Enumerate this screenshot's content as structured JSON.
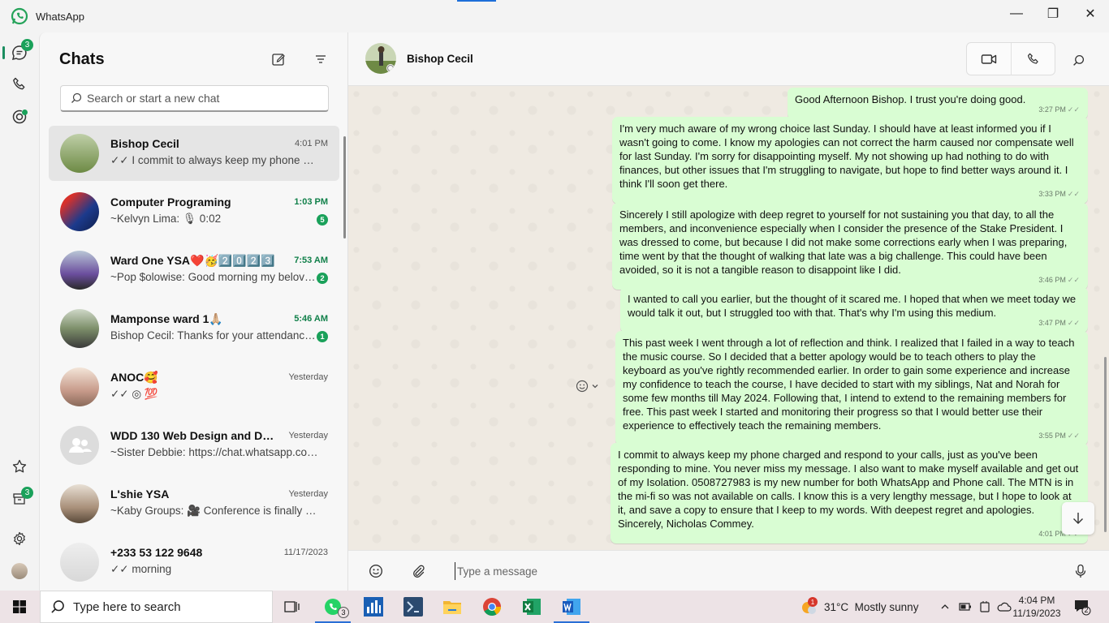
{
  "window": {
    "title": "WhatsApp",
    "minimize": "—",
    "maximize": "❐",
    "close": "✕"
  },
  "rail": {
    "chats_badge": "3",
    "archive_badge": "3"
  },
  "chatlist": {
    "title": "Chats",
    "search_placeholder": "Search or start a new chat",
    "chats": [
      {
        "name": "Bishop Cecil",
        "time": "4:01 PM",
        "preview": "✓✓ I commit to always keep my phone cha...",
        "unread": "",
        "selected": true
      },
      {
        "name": "Computer Programing",
        "time": "1:03 PM",
        "preview": "~Kelvyn Lima: 🎙 0:02",
        "unread": "5"
      },
      {
        "name": "Ward One YSA❤️🥳2️⃣0️⃣2️⃣3️⃣",
        "time": "7:53 AM",
        "preview": "~Pop $olowise: Good morning my belove...",
        "unread": "2"
      },
      {
        "name": "Mamponse ward 1🙏🏼",
        "time": "5:46 AM",
        "preview": "Bishop Cecil: Thanks for your attendance...",
        "unread": "1"
      },
      {
        "name": "ANOC🥰",
        "time": "Yesterday",
        "preview": "✓✓ ◎ 💯",
        "unread": ""
      },
      {
        "name": "WDD 130 Web Design and Devel...",
        "time": "Yesterday",
        "preview": "~Sister Debbie: https://chat.whatsapp.com...",
        "unread": ""
      },
      {
        "name": "L'shie YSA",
        "time": "Yesterday",
        "preview": "~Kaby Groups: 🎥 Conference is finally her...",
        "unread": ""
      },
      {
        "name": "+233 53 122 9648",
        "time": "11/17/2023",
        "preview": "✓✓ morning",
        "unread": ""
      }
    ]
  },
  "conversation": {
    "contact_name": "Bishop Cecil",
    "composer_placeholder": "Type a message",
    "messages": [
      {
        "text": "Good Afternoon Bishop. I trust you're doing good.",
        "time": "3:27 PM"
      },
      {
        "text": "I'm very much aware of my wrong choice last Sunday. I should have at least informed you if I wasn't going to come. I know my apologies can not correct the harm caused nor compensate well for last Sunday. I'm sorry for disappointing myself. My not showing up had nothing to do with finances, but other issues that I'm struggling to navigate, but hope to find better ways around it. I think I'll soon get there.",
        "time": "3:33 PM"
      },
      {
        "text": "Sincerely I still apologize with deep regret to yourself for not sustaining you that day, to all the members, and inconvenience especially when I consider the presence of the Stake President. I was dressed to come, but because I did not make some corrections early when I was preparing, time went by that the thought of walking that late was a big challenge. This could have been avoided, so it is not a tangible reason to disappoint like I did.",
        "time": "3:46 PM"
      },
      {
        "text": "I wanted to call you earlier, but the thought of it scared me. I hoped that when we meet today we would talk it out, but I struggled too with that. That's why I'm using this medium.",
        "time": "3:47 PM"
      },
      {
        "text": "This past week I went through a lot of reflection and think. I realized that I failed in a way to teach the music course. So I decided that a better apology would be to teach others to play the keyboard as you've rightly recommended earlier. In order to gain some experience and increase my confidence to teach the course, I have decided to start with my siblings, Nat and Norah for some few months till May 2024. Following that, I intend to extend to the remaining members for free. This past week I started and monitoring their progress so that I would better use their experience to effectively teach the remaining members.",
        "time": "3:55 PM"
      },
      {
        "text": "I commit to always keep my phone charged and respond to your calls, just as you've been responding to mine. You never miss my message. I also want to make myself available and get out of my Isolation. 0508727983 is my new number for both WhatsApp and Phone call. The MTN is in the mi-fi so was not available on calls. I know this is a very lengthy message, but I hope to look at it, and save a copy to ensure that I keep to my words. With deepest regret and apologies. Sincerely, Nicholas Commey.",
        "time": "4:01 PM"
      }
    ]
  },
  "taskbar": {
    "search_placeholder": "Type here to search",
    "whatsapp_badge": "3",
    "weather_badge": "1",
    "weather": "31°C  Mostly sunny",
    "clock_time": "4:04 PM",
    "clock_date": "11/19/2023",
    "notification_count": "2"
  },
  "colors": {
    "accent": "#1aa15a",
    "bubble": "#d9fdd3",
    "chat_bg": "#efeae2"
  }
}
